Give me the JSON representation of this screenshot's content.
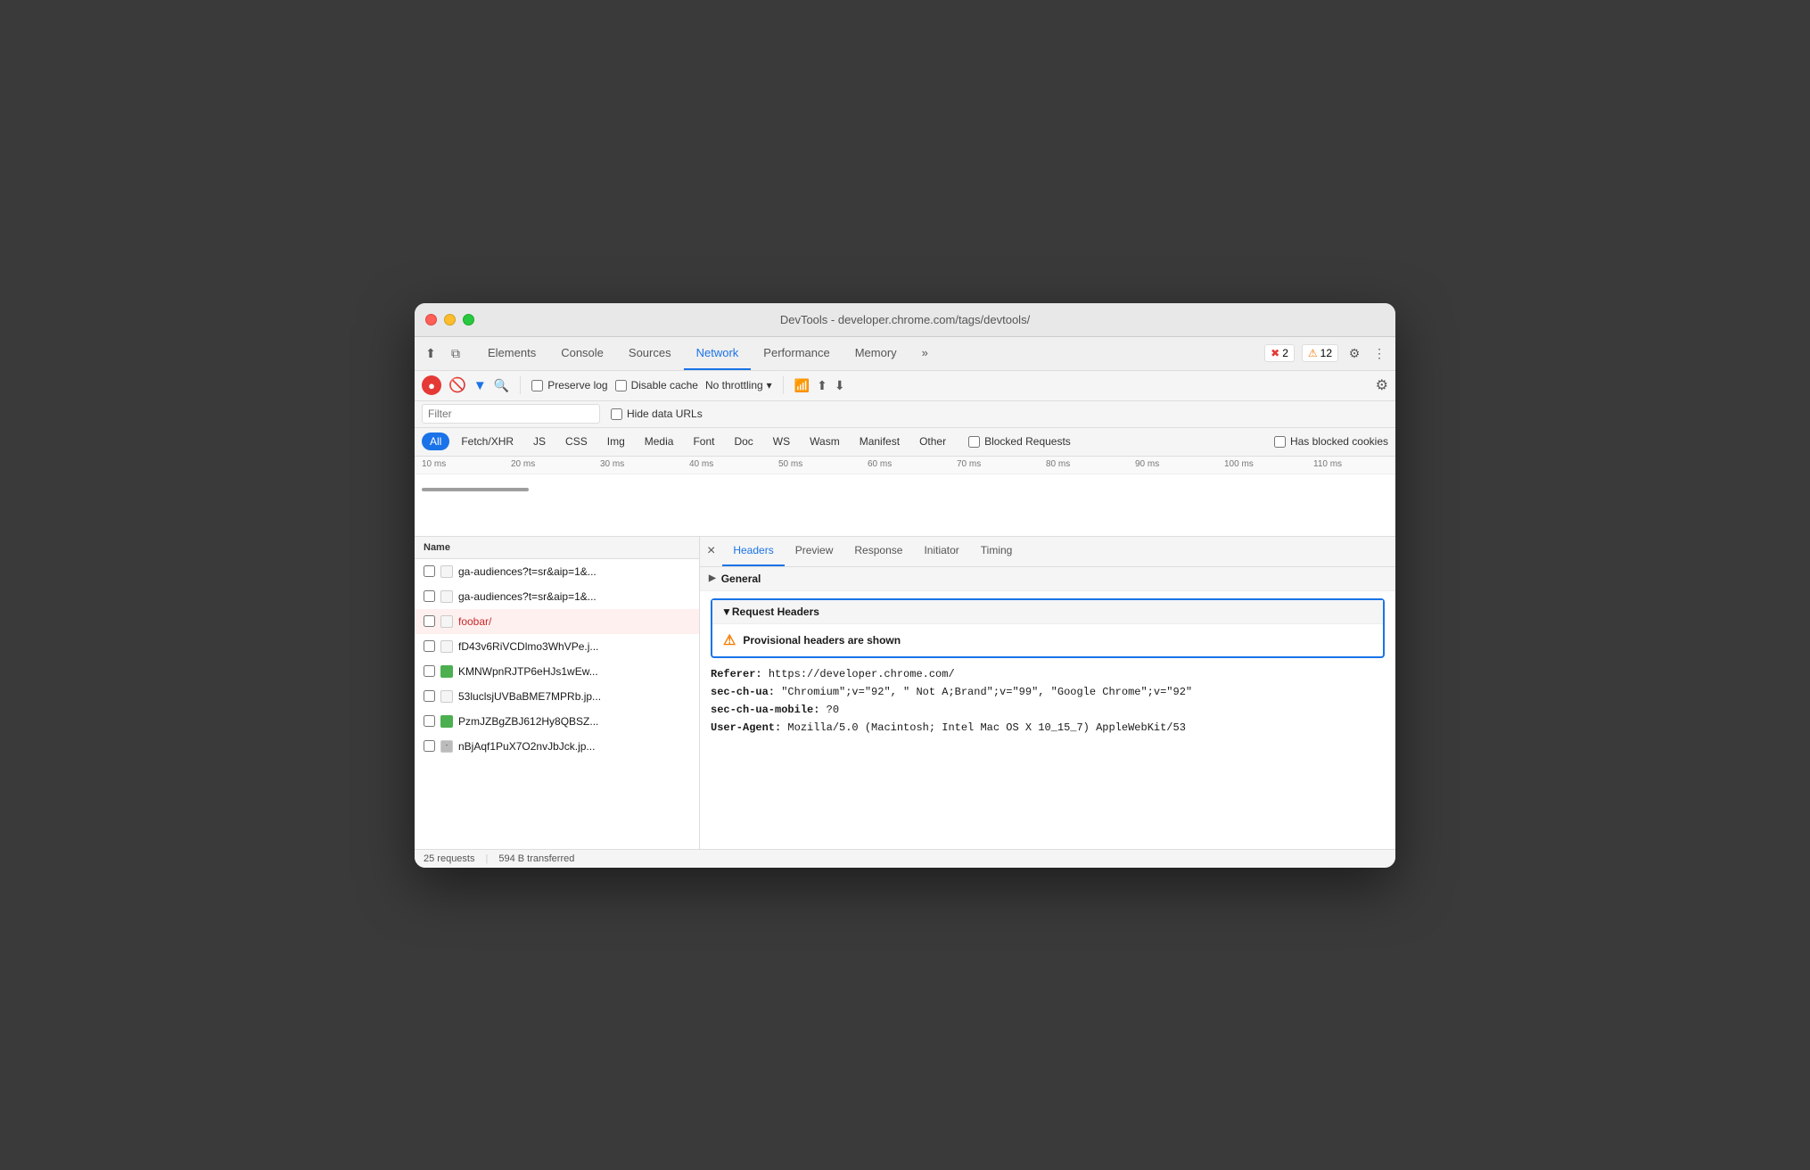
{
  "window": {
    "title": "DevTools - developer.chrome.com/tags/devtools/"
  },
  "titlebar": {
    "traffic": {
      "close": "close",
      "minimize": "minimize",
      "maximize": "maximize"
    }
  },
  "devtools_tabs": {
    "items": [
      {
        "label": "Elements",
        "active": false
      },
      {
        "label": "Console",
        "active": false
      },
      {
        "label": "Sources",
        "active": false
      },
      {
        "label": "Network",
        "active": true
      },
      {
        "label": "Performance",
        "active": false
      },
      {
        "label": "Memory",
        "active": false
      }
    ],
    "more_label": "»",
    "error_count": "2",
    "warning_count": "12"
  },
  "toolbar": {
    "preserve_log_label": "Preserve log",
    "disable_cache_label": "Disable cache",
    "throttling_label": "No throttling",
    "filter_placeholder": "Filter"
  },
  "filter_bar": {
    "filter_label": "Filter",
    "hide_data_urls_label": "Hide data URLs"
  },
  "type_filters": {
    "items": [
      {
        "label": "All",
        "active": true
      },
      {
        "label": "Fetch/XHR",
        "active": false
      },
      {
        "label": "JS",
        "active": false
      },
      {
        "label": "CSS",
        "active": false
      },
      {
        "label": "Img",
        "active": false
      },
      {
        "label": "Media",
        "active": false
      },
      {
        "label": "Font",
        "active": false
      },
      {
        "label": "Doc",
        "active": false
      },
      {
        "label": "WS",
        "active": false
      },
      {
        "label": "Wasm",
        "active": false
      },
      {
        "label": "Manifest",
        "active": false
      },
      {
        "label": "Other",
        "active": false
      }
    ],
    "has_blocked_cookies_label": "Has blocked cookies",
    "blocked_requests_label": "Blocked Requests"
  },
  "timeline": {
    "labels": [
      "10 ms",
      "20 ms",
      "30 ms",
      "40 ms",
      "50 ms",
      "60 ms",
      "70 ms",
      "80 ms",
      "90 ms",
      "100 ms",
      "110 ms"
    ]
  },
  "request_list": {
    "header": "Name",
    "items": [
      {
        "name": "ga-audiences?t=sr&aip=1&...",
        "icon": "doc",
        "selected": false,
        "error": false
      },
      {
        "name": "ga-audiences?t=sr&aip=1&...",
        "icon": "doc",
        "selected": false,
        "error": false
      },
      {
        "name": "foobar/",
        "icon": "doc",
        "selected": true,
        "error": true
      },
      {
        "name": "fD43v6RiVCDlmo3WhVPe.j...",
        "icon": "doc",
        "selected": false,
        "error": false
      },
      {
        "name": "KMNWpnRJTP6eHJs1wEw...",
        "icon": "img",
        "selected": false,
        "error": false
      },
      {
        "name": "53luclsjUVBaBME7MPRb.jp...",
        "icon": "doc",
        "selected": false,
        "error": false
      },
      {
        "name": "PzmJZBgZBJ612Hy8QBSZ...",
        "icon": "img",
        "selected": false,
        "error": false
      },
      {
        "name": "nBjAqf1PuX7O2nvJbJck.jp...",
        "icon": "img-close",
        "selected": false,
        "error": false
      }
    ]
  },
  "details": {
    "close_label": "×",
    "tabs": [
      {
        "label": "Headers",
        "active": true
      },
      {
        "label": "Preview",
        "active": false
      },
      {
        "label": "Response",
        "active": false
      },
      {
        "label": "Initiator",
        "active": false
      },
      {
        "label": "Timing",
        "active": false
      }
    ],
    "general_section": {
      "label": "General"
    },
    "request_headers": {
      "title": "Request Headers",
      "provisional_warning": "Provisional headers are shown",
      "headers": [
        {
          "name": "Referer:",
          "value": " https://developer.chrome.com/"
        },
        {
          "name": "sec-ch-ua:",
          "value": " \"Chromium\";v=\"92\", \" Not A;Brand\";v=\"99\", \"Google Chrome\";v=\"92\""
        },
        {
          "name": "sec-ch-ua-mobile:",
          "value": " ?0"
        },
        {
          "name": "User-Agent:",
          "value": " Mozilla/5.0 (Macintosh; Intel Mac OS X 10_15_7) AppleWebKit/53"
        }
      ]
    }
  },
  "status_bar": {
    "requests_label": "25 requests",
    "transferred_label": "594 B transferred"
  }
}
